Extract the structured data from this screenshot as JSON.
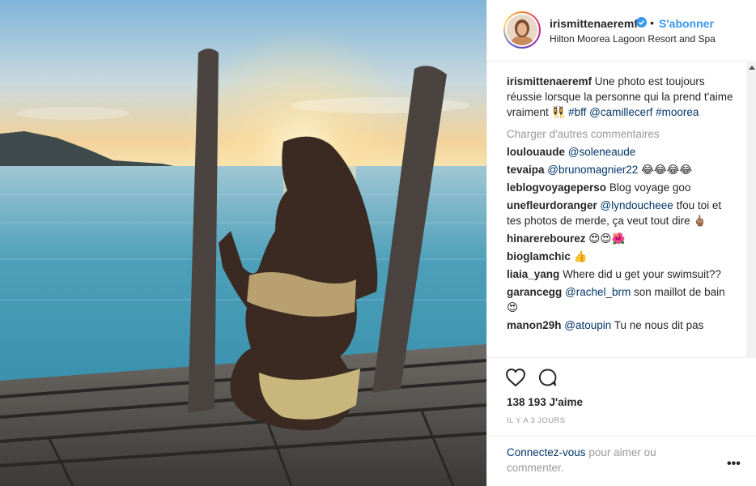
{
  "post": {
    "username": "irismittenaeremf",
    "separator": "•",
    "follow_label": "S'abonner",
    "location": "Hilton Moorea Lagoon Resort and Spa",
    "caption": {
      "username": "irismittenaeremf",
      "text": " Une photo est toujours réussie lorsque la personne qui la prend t'aime vraiment 👯‍♀️ ",
      "tags": [
        "#bff",
        "@camillecerf",
        "#moorea"
      ]
    },
    "load_more": "Charger d'autres commentaires",
    "comments": [
      {
        "user": "loulouaude",
        "mention": "@soleneaude",
        "text": ""
      },
      {
        "user": "tevaipa",
        "mention": "@brunomagnier22",
        "text": " 😂😂😂😂"
      },
      {
        "user": "leblogvoyageperso",
        "mention": "",
        "text": "Blog voyage goo"
      },
      {
        "user": "unefleurdoranger",
        "mention": "@lyndoucheee",
        "text": " tfou toi et tes photos de merde, ça veut tout dire 🖕🏽"
      },
      {
        "user": "hinarereboure​z",
        "mention": "",
        "text": "😍😍🌺"
      },
      {
        "user": "bioglamchic",
        "mention": "",
        "text": "👍"
      },
      {
        "user": "liaia_yang",
        "mention": "",
        "text": "Where did u get your swimsuit??"
      },
      {
        "user": "garancegg",
        "mention": "@rachel_brm",
        "text": " son maillot de bain 😍"
      },
      {
        "user": "manon29h",
        "mention": "@atoupin",
        "text": " Tu ne nous dit pas"
      }
    ],
    "likes": "138 193 J'aime",
    "time": "IL Y A 3 JOURS",
    "login_link": "Connectez-vous",
    "login_text": " pour aimer ou commenter.",
    "more_label": "•••",
    "icons": [
      "heart-icon",
      "comment-icon",
      "verified-badge-icon",
      "more-icon"
    ],
    "colors": {
      "link": "#3897f0",
      "tag": "#003569",
      "muted": "#999999"
    }
  }
}
